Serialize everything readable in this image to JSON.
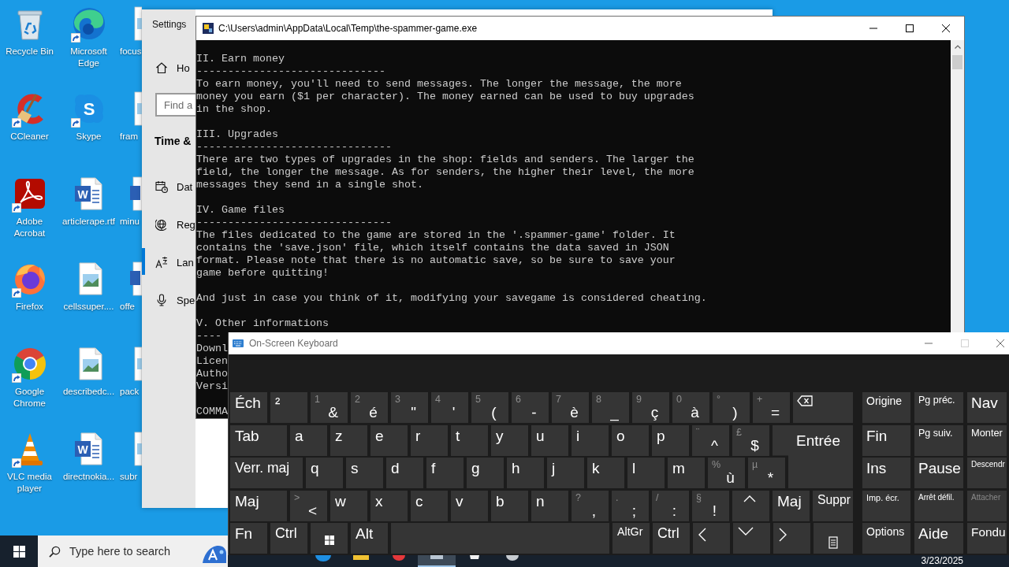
{
  "desktop": {
    "columns": [
      [
        {
          "label": "Recycle Bin",
          "kind": "bin",
          "shortcut": false
        },
        {
          "label": "CCleaner",
          "kind": "cleaner",
          "shortcut": true
        },
        {
          "label": "Adobe Acrobat",
          "kind": "acrobat",
          "shortcut": true
        },
        {
          "label": "Firefox",
          "kind": "firefox",
          "shortcut": true
        },
        {
          "label": "Google Chrome",
          "kind": "chrome",
          "shortcut": true
        },
        {
          "label": "VLC media player",
          "kind": "vlc",
          "shortcut": true
        }
      ],
      [
        {
          "label": "Microsoft Edge",
          "kind": "edge",
          "shortcut": true
        },
        {
          "label": "Skype",
          "kind": "skype",
          "shortcut": true,
          "logo_letter": "S"
        },
        {
          "label": "articlerape.rtf",
          "kind": "word",
          "shortcut": false,
          "logo_letter": "W"
        },
        {
          "label": "cellssuper....",
          "kind": "image",
          "shortcut": false
        },
        {
          "label": "describedc...",
          "kind": "image",
          "shortcut": false
        },
        {
          "label": "directnokia...",
          "kind": "word",
          "shortcut": false,
          "logo_letter": "W"
        }
      ],
      [
        {
          "label": "focus",
          "kind": "image",
          "shortcut": false
        },
        {
          "label": "fram",
          "kind": "image",
          "shortcut": false
        },
        {
          "label": "minu",
          "kind": "word",
          "shortcut": false
        },
        {
          "label": "offe",
          "kind": "word",
          "shortcut": false
        },
        {
          "label": "pack",
          "kind": "image",
          "shortcut": false
        },
        {
          "label": "subr",
          "kind": "image",
          "shortcut": false
        }
      ]
    ]
  },
  "settings": {
    "title": "Settings",
    "home": {
      "label": "Ho"
    },
    "search": {
      "placeholder": "Find a"
    },
    "heading": "Time &",
    "nav": [
      {
        "label": "Dat",
        "kind": "date",
        "selected": false
      },
      {
        "label": "Reg",
        "kind": "region",
        "selected": false
      },
      {
        "label": "Lan",
        "kind": "language",
        "selected": true
      },
      {
        "label": "Spe",
        "kind": "speech",
        "selected": false
      }
    ]
  },
  "console": {
    "title": "C:\\Users\\admin\\AppData\\Local\\Temp\\the-spammer-game.exe",
    "active": true,
    "sections": [
      {
        "heading": "II. Earn money",
        "rule": "------------------------------",
        "paragraphs": [
          [
            "To earn money, you'll need to send messages. The longer the message, the more",
            "money you earn ($1 per character). The money earned can be used to buy upgrades",
            "in the shop."
          ]
        ]
      },
      {
        "heading": "III. Upgrades",
        "rule": "-------------------------------",
        "paragraphs": [
          [
            "There are two types of upgrades in the shop: fields and senders. The larger the",
            "field, the longer the message. As for senders, the higher their level, the more",
            "messages they send in a single shot."
          ]
        ]
      },
      {
        "heading": "IV. Game files",
        "rule": "-------------------------------",
        "paragraphs": [
          [
            "The files dedicated to the game are stored in the '.spammer-game' folder. It",
            "contains the 'save.json' file, which itself contains the data saved in JSON",
            "format. Please note that there is no automatic save, so be sure to save your",
            "game before quitting!"
          ],
          [
            "And just in case you think of it, modifying your savegame is considered cheating."
          ]
        ]
      },
      {
        "heading": "V. Other informations",
        "rule": "----",
        "paragraphs": [
          [
            "Downl",
            "Licen",
            "Autho",
            "Versi"
          ]
        ]
      },
      {
        "heading": "COMMA"
      }
    ]
  },
  "keyboard": {
    "title": "On-Screen Keyboard",
    "active": false,
    "maximize_disabled": true,
    "main_rows": [
      [
        {
          "kind": "label",
          "label": "Éch"
        },
        {
          "kind": "label",
          "label": "²"
        },
        {
          "kind": "dual",
          "shift": "1",
          "label": "&"
        },
        {
          "kind": "dual",
          "shift": "2",
          "label": "é"
        },
        {
          "kind": "dual",
          "shift": "3",
          "label": "\""
        },
        {
          "kind": "dual",
          "shift": "4",
          "label": "'"
        },
        {
          "kind": "dual",
          "shift": "5",
          "label": "("
        },
        {
          "kind": "dual",
          "shift": "6",
          "label": "-"
        },
        {
          "kind": "dual",
          "shift": "7",
          "label": "è"
        },
        {
          "kind": "dual",
          "shift": "8",
          "label": "_"
        },
        {
          "kind": "dual",
          "shift": "9",
          "label": "ç"
        },
        {
          "kind": "dual",
          "shift": "0",
          "label": "à"
        },
        {
          "kind": "dual",
          "shift": "°",
          "label": ")"
        },
        {
          "kind": "dual",
          "shift": "+",
          "label": "="
        },
        {
          "kind": "backspace"
        }
      ],
      [
        {
          "kind": "label",
          "label": "Tab"
        },
        {
          "kind": "label",
          "label": "a"
        },
        {
          "kind": "label",
          "label": "z"
        },
        {
          "kind": "label",
          "label": "e"
        },
        {
          "kind": "label",
          "label": "r"
        },
        {
          "kind": "label",
          "label": "t"
        },
        {
          "kind": "label",
          "label": "y"
        },
        {
          "kind": "label",
          "label": "u"
        },
        {
          "kind": "label",
          "label": "i"
        },
        {
          "kind": "label",
          "label": "o"
        },
        {
          "kind": "label",
          "label": "p"
        },
        {
          "kind": "dual",
          "shift": "¨",
          "label": "^"
        },
        {
          "kind": "dual",
          "shift": "£",
          "label": "$"
        },
        {
          "kind": "enter",
          "label": "Entrée"
        }
      ],
      [
        {
          "kind": "label",
          "label": "Verr. maj"
        },
        {
          "kind": "label",
          "label": "q"
        },
        {
          "kind": "label",
          "label": "s"
        },
        {
          "kind": "label",
          "label": "d"
        },
        {
          "kind": "label",
          "label": "f"
        },
        {
          "kind": "label",
          "label": "g"
        },
        {
          "kind": "label",
          "label": "h"
        },
        {
          "kind": "label",
          "label": "j"
        },
        {
          "kind": "label",
          "label": "k"
        },
        {
          "kind": "label",
          "label": "l"
        },
        {
          "kind": "label",
          "label": "m"
        },
        {
          "kind": "dual",
          "shift": "%",
          "label": "ù"
        },
        {
          "kind": "dual",
          "shift": "µ",
          "label": "*"
        }
      ],
      [
        {
          "kind": "label",
          "label": "Maj"
        },
        {
          "kind": "dual",
          "shift": ">",
          "label": "<"
        },
        {
          "kind": "label",
          "label": "w"
        },
        {
          "kind": "label",
          "label": "x"
        },
        {
          "kind": "label",
          "label": "c"
        },
        {
          "kind": "label",
          "label": "v"
        },
        {
          "kind": "label",
          "label": "b"
        },
        {
          "kind": "label",
          "label": "n"
        },
        {
          "kind": "dual",
          "shift": "?",
          "label": ","
        },
        {
          "kind": "dual",
          "shift": ".",
          "label": ";"
        },
        {
          "kind": "dual",
          "shift": "/",
          "label": ":"
        },
        {
          "kind": "dual",
          "shift": "§",
          "label": "!"
        },
        {
          "kind": "up"
        },
        {
          "kind": "label",
          "label": "Maj"
        },
        {
          "kind": "label",
          "label": "Suppr"
        }
      ],
      [
        {
          "kind": "label",
          "label": "Fn"
        },
        {
          "kind": "label",
          "label": "Ctrl"
        },
        {
          "kind": "windows"
        },
        {
          "kind": "label",
          "label": "Alt"
        },
        {
          "kind": "space"
        },
        {
          "kind": "label",
          "label": "AltGr"
        },
        {
          "kind": "label",
          "label": "Ctrl"
        },
        {
          "kind": "left"
        },
        {
          "kind": "down"
        },
        {
          "kind": "right"
        },
        {
          "kind": "menu"
        }
      ]
    ],
    "nav_keys": [
      [
        {
          "label": "Origine",
          "disabled": false
        },
        {
          "label": "Pg préc.",
          "disabled": false
        },
        {
          "label": "Nav",
          "disabled": false
        }
      ],
      [
        {
          "label": "Fin",
          "disabled": false
        },
        {
          "label": "Pg suiv.",
          "disabled": false
        },
        {
          "label": "Monter",
          "disabled": false
        }
      ],
      [
        {
          "label": "Ins",
          "disabled": false
        },
        {
          "label": "Pause",
          "disabled": false
        },
        {
          "label": "Descendr",
          "disabled": false
        }
      ],
      [
        {
          "label": "Imp. écr.",
          "disabled": false
        },
        {
          "label": "Arrêt défil.",
          "disabled": false
        },
        {
          "label": "Attacher",
          "disabled": true
        }
      ],
      [
        {
          "label": "Options",
          "disabled": false
        },
        {
          "label": "Aide",
          "disabled": false
        },
        {
          "label": "Fondu",
          "disabled": false
        }
      ]
    ]
  },
  "taskbar": {
    "search": {
      "placeholder": "Type here to search"
    },
    "apps": [
      {
        "kind": "circle",
        "selected": false
      },
      {
        "kind": "folder",
        "selected": false
      },
      {
        "kind": "dot",
        "selected": false
      },
      {
        "kind": "window",
        "selected": true
      },
      {
        "kind": "bag",
        "selected": false
      },
      {
        "kind": "disc",
        "selected": false
      }
    ],
    "date": "3/23/2025"
  }
}
